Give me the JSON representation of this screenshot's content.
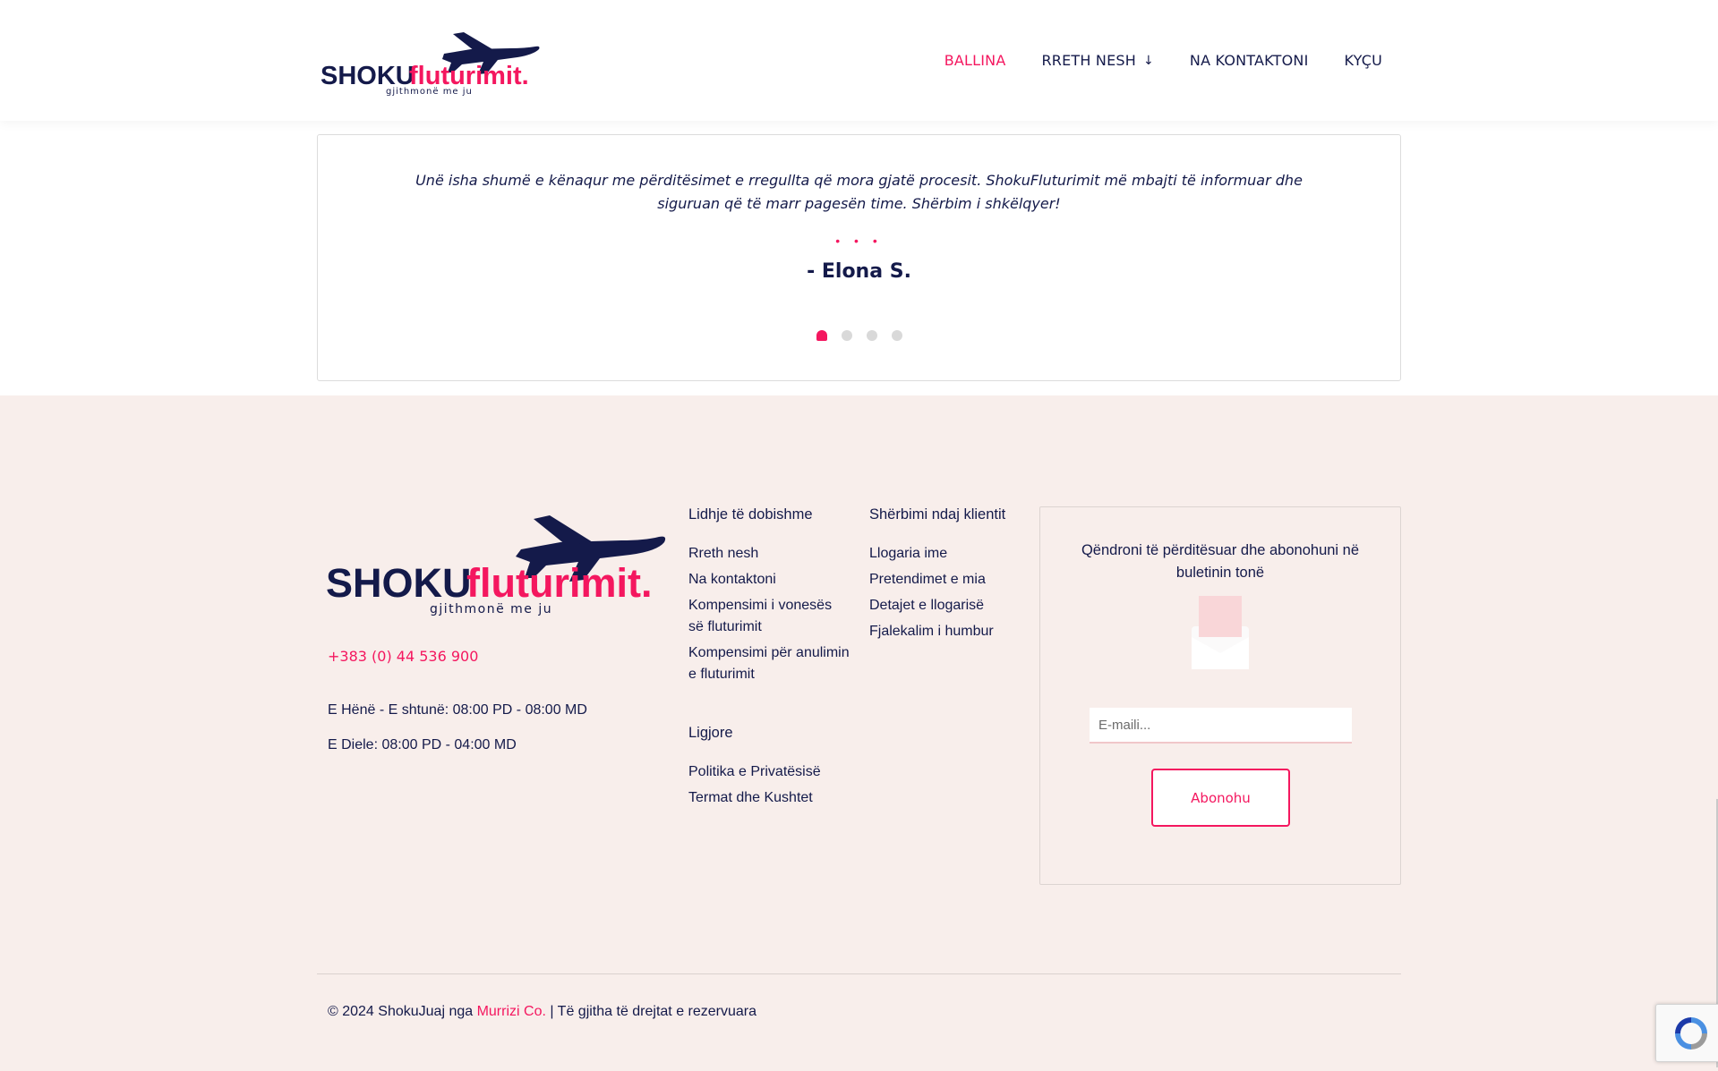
{
  "logo": {
    "brand_dark": "SHOKU",
    "brand_accent": "fluturimit.",
    "tagline": "gjithmonë me ju"
  },
  "nav": {
    "items": [
      {
        "label": "BALLINA",
        "active": true
      },
      {
        "label": "RRETH NESH",
        "has_dropdown": true
      },
      {
        "label": "NA KONTAKTONI"
      },
      {
        "label": "KYÇU"
      }
    ]
  },
  "testimonial": {
    "quote": "Unë isha shumë e kënaqur me përditësimet e rregullta që mora gjatë procesit. ShokuFluturimit më mbajti të informuar dhe siguruan që të marr pagesën time. Shërbim i shkëlqyer!",
    "decoration": "• • •",
    "author": "- Elona S.",
    "slides": 4,
    "active_slide": 1
  },
  "footer": {
    "phone": "+383 (0) 44 536 900",
    "hours": [
      "E Hënë - E shtunë: 08:00 PD - 08:00 MD",
      "E Diele: 08:00 PD - 04:00 MD"
    ],
    "useful_links": {
      "title": "Lidhje të dobishme",
      "items": [
        "Rreth nesh",
        "Na kontaktoni",
        "Kompensimi i vonesës së fluturimit",
        "Kompensimi për anulimin e fluturimit"
      ]
    },
    "legal": {
      "title": "Ligjore",
      "items": [
        "Politika e Privatësisë",
        "Termat dhe Kushtet"
      ]
    },
    "customer_service": {
      "title": "Shërbimi ndaj klientit",
      "items": [
        "Llogaria ime",
        "Pretendimet e mia",
        "Detajet e llogarisë",
        "Fjalekalim i humbur"
      ]
    },
    "newsletter": {
      "title": "Qëndroni të përditësuar dhe abonohuni në buletinin tonë",
      "email_placeholder": "E-maili...",
      "button": "Abonohu"
    },
    "copyright": {
      "prefix": "© 2024 ShokuJuaj nga ",
      "company": "Murrizi Co.",
      "suffix": " | Të gjitha të drejtat e rezervuara"
    }
  },
  "colors": {
    "accent": "#f4175f",
    "navy": "#141a4a",
    "footer_bg": "#f8eeeb"
  }
}
